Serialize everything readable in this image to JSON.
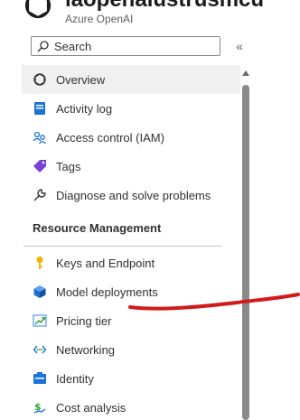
{
  "header": {
    "resource_name": "iaopenaiustrusmcu",
    "subtitle": "Azure OpenAI"
  },
  "search": {
    "placeholder": "Search",
    "collapse_glyph": "«"
  },
  "nav": {
    "items": [
      {
        "label": "Overview",
        "icon": "openai-icon",
        "selected": true
      },
      {
        "label": "Activity log",
        "icon": "activity-log-icon"
      },
      {
        "label": "Access control (IAM)",
        "icon": "access-control-icon"
      },
      {
        "label": "Tags",
        "icon": "tag-icon"
      },
      {
        "label": "Diagnose and solve problems",
        "icon": "wrench-icon"
      }
    ],
    "section_title": "Resource Management",
    "section_items": [
      {
        "label": "Keys and Endpoint",
        "icon": "key-icon"
      },
      {
        "label": "Model deployments",
        "icon": "cube-icon"
      },
      {
        "label": "Pricing tier",
        "icon": "pricing-tier-icon"
      },
      {
        "label": "Networking",
        "icon": "networking-icon"
      },
      {
        "label": "Identity",
        "icon": "identity-icon"
      },
      {
        "label": "Cost analysis",
        "icon": "cost-analysis-icon"
      }
    ]
  },
  "colors": {
    "selected_bg": "#f0f0f0",
    "annotation": "#d11a1a"
  }
}
